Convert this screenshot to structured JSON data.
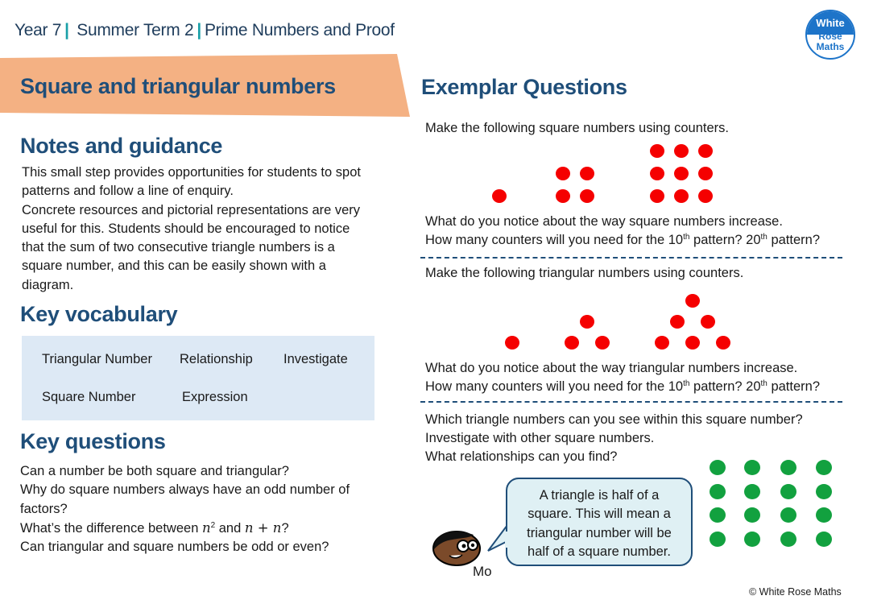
{
  "header": {
    "breadcrumb": [
      "Year 7",
      "Summer Term 2",
      "Prime Numbers and Proof"
    ],
    "separator": "|",
    "logo": {
      "line1": "White",
      "line2": "Rose",
      "line3": "Maths"
    }
  },
  "step_title": "Square and triangular numbers",
  "colors": {
    "title_band": "#f4b183",
    "heading": "#1f4e79",
    "breadcrumb_separator": "#1aa0a8",
    "vocab_box": "#dde9f5",
    "square_counters": "#f50000",
    "grid_counters": "#12a13f",
    "bubble_fill": "#dff0f4",
    "logo_blue": "#1d74c9"
  },
  "notes": {
    "heading": "Notes and guidance",
    "lines": [
      "This small step provides opportunities for students to spot",
      "patterns and follow a line of enquiry.",
      "Concrete resources and pictorial representations are very",
      "useful for this. Students should be encouraged to notice",
      "that the sum of two consecutive triangle numbers is a",
      "square number, and this can be easily shown with a",
      "diagram."
    ]
  },
  "vocabulary": {
    "heading": "Key vocabulary",
    "terms": [
      "Triangular Number",
      "Relationship",
      "Investigate",
      "Square Number",
      "Expression"
    ]
  },
  "key_questions": {
    "heading": "Key questions",
    "q1": "Can a number be both square and triangular?",
    "q2a": "Why do square numbers always have an odd number of",
    "q2b": "factors?",
    "q3_prefix": "What’s the difference between ",
    "q3_n": "n",
    "q3_exp": "2",
    "q3_and": " and ",
    "q3_expr": "n + n",
    "q3_suffix": "?",
    "q4": "Can triangular and square numbers be odd or even?"
  },
  "exemplar": {
    "heading": "Exemplar Questions",
    "square_prompt": "Make the following square numbers using counters.",
    "square_patterns": [
      1,
      4,
      9
    ],
    "square_notice": "What do you notice about the way square numbers increase.",
    "counters_q_prefix": "How many counters will you need for the ",
    "ord10": "10",
    "ord20": "20",
    "th": "th",
    "pattern_q": " pattern? ",
    "pattern_end": " pattern?",
    "triangle_prompt": "Make the following triangular numbers using counters.",
    "triangle_patterns": [
      1,
      3,
      6
    ],
    "triangle_notice": "What do you notice about the way triangular numbers increase.",
    "investigate_lines": [
      "Which triangle numbers can you see within this square number?",
      "Investigate with other square numbers.",
      "What relationships can you find?"
    ],
    "grid_size": 4
  },
  "speech": {
    "character": "Mo",
    "lines": [
      "A triangle is half of a",
      "square. This will mean a",
      "triangular number will be",
      "half of a square number."
    ]
  },
  "footer": {
    "copyright": "© White Rose Maths"
  }
}
